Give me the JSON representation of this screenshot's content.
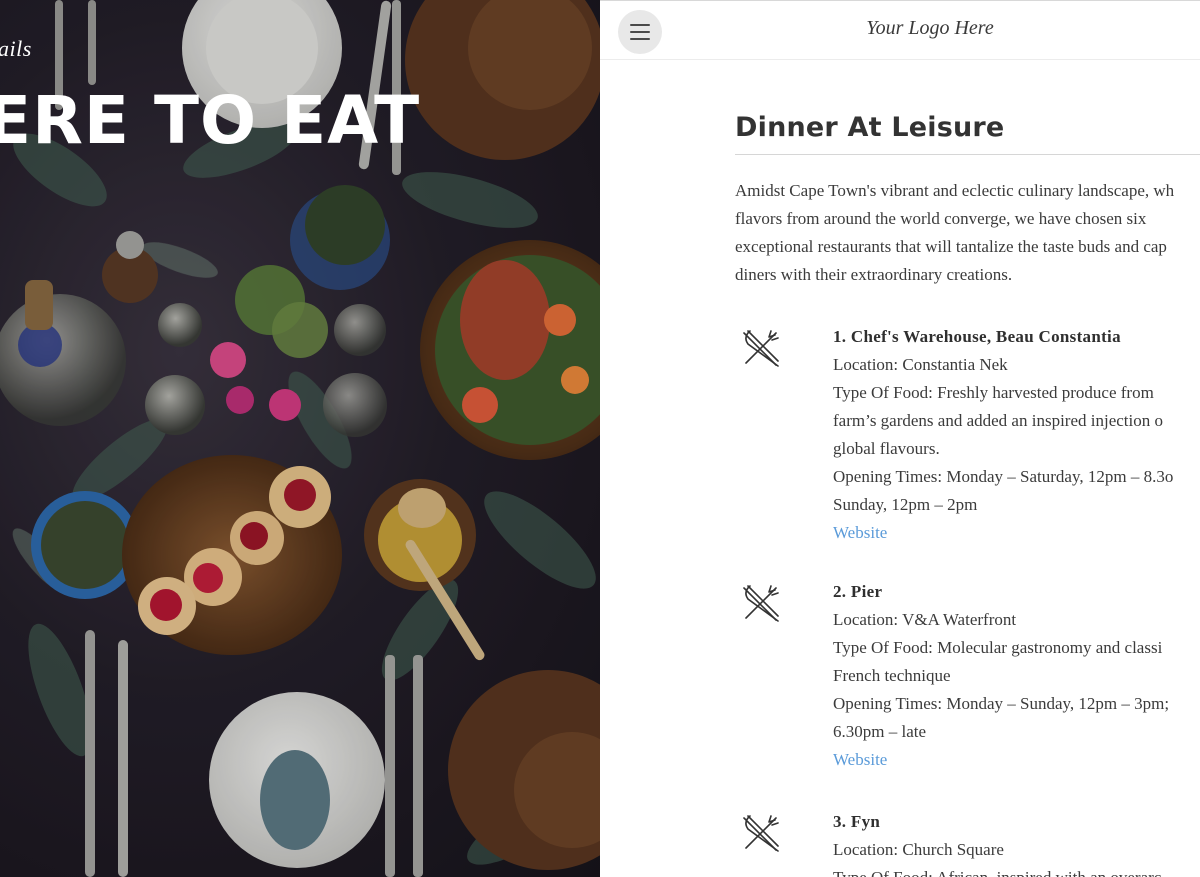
{
  "hero": {
    "kicker": "ails",
    "headline": "ERE TO EAT"
  },
  "header": {
    "menu_icon": "hamburger-icon",
    "logo": "Your Logo Here"
  },
  "section": {
    "title": "Dinner At Leisure",
    "intro": "Amidst Cape Town's vibrant and eclectic culinary landscape, wh flavors from around the world converge, we have chosen six exceptional restaurants that will tantalize the taste buds and cap diners with their extraordinary creations."
  },
  "restaurants": [
    {
      "icon": "fork-knife-icon",
      "name": "1. Chef's Warehouse, Beau Constantia",
      "location": "Location: Constantia Nek",
      "food": "Type Of Food: Freshly harvested produce from farm's gardens and added an inspired injection o global flavours.",
      "times": "Opening Times: Monday – Saturday, 12pm – 8.3o Sunday, 12pm – 2pm",
      "link": "Website"
    },
    {
      "icon": "fork-knife-icon",
      "name": "2. Pier",
      "location": "Location: V&A Waterfront",
      "food": "Type Of Food: Molecular gastronomy and classi French technique",
      "times": "Opening Times: Monday – Sunday, 12pm – 3pm; 6.30pm – late",
      "link": "Website"
    },
    {
      "icon": "fork-knife-icon",
      "name": "3. Fyn",
      "location": "Location: Church Square",
      "food": "Type Of Food: African, inspired with an overarc"
    }
  ],
  "colors": {
    "link": "#5b9bd9",
    "text": "#3b3b3b",
    "menu_button_bg": "#e8e8e8"
  }
}
